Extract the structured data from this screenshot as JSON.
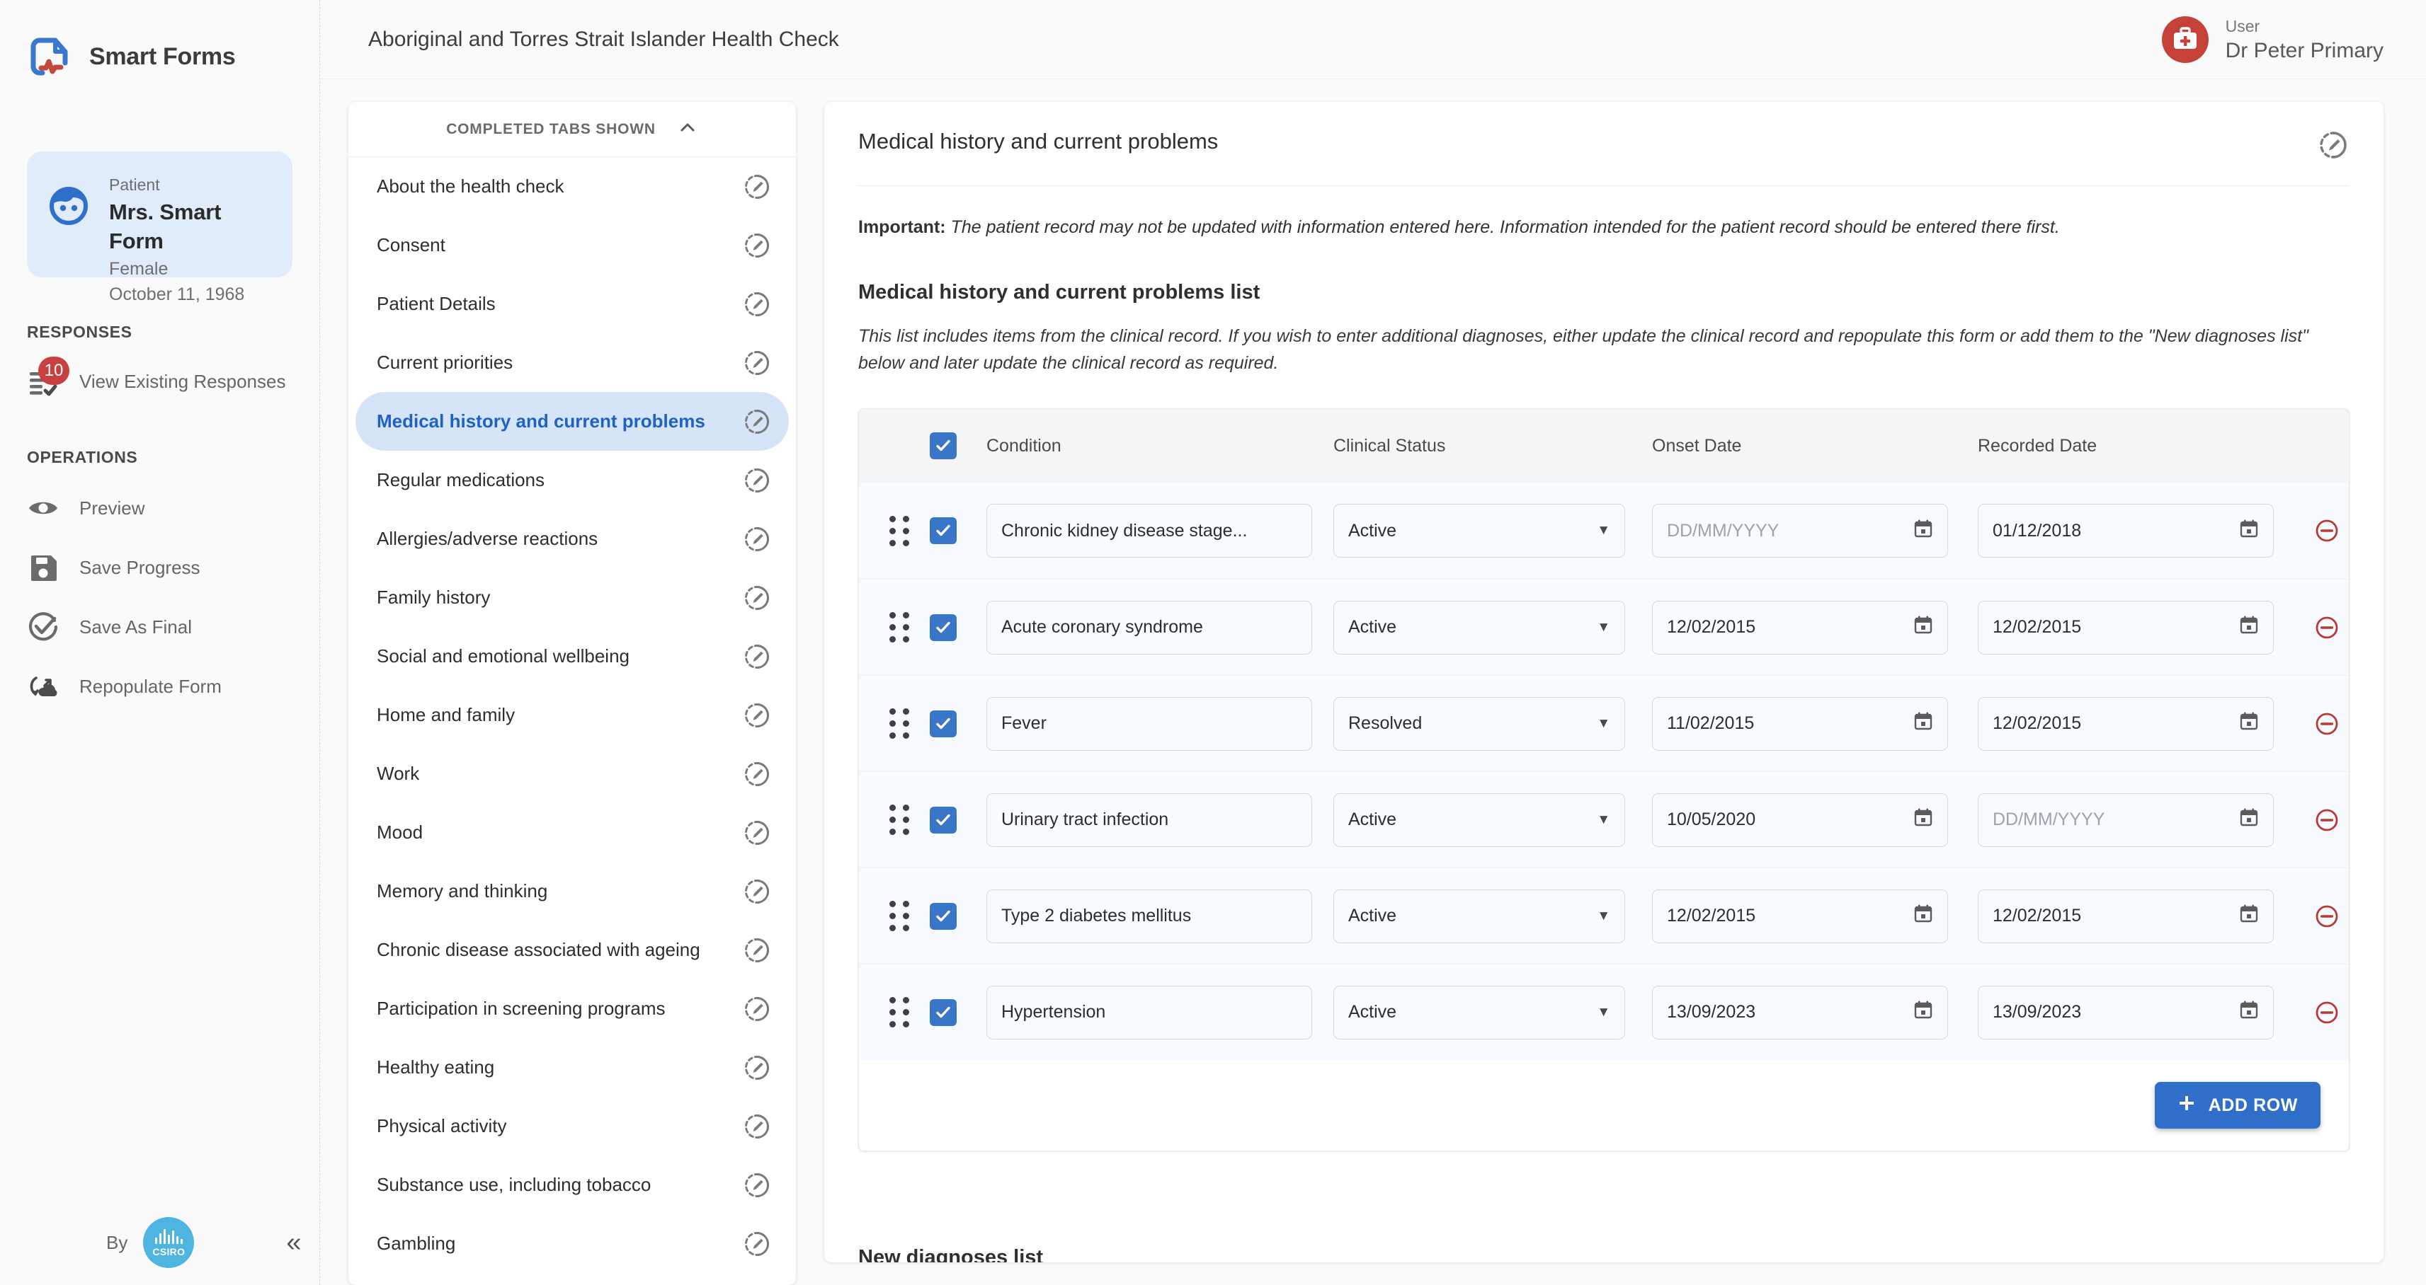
{
  "brand": {
    "name": "Smart Forms",
    "logo_icon": "document-pulse-icon"
  },
  "header": {
    "title": "Aboriginal and Torres Strait Islander Health Check",
    "user_role_label": "User",
    "user_name": "Dr Peter Primary",
    "avatar_icon": "medical-bag-icon"
  },
  "sidebar": {
    "patient": {
      "label": "Patient",
      "name": "Mrs. Smart Form",
      "sex": "Female",
      "dob": "October 11, 1968",
      "avatar_icon": "patient-face-icon"
    },
    "responses_section": "RESPONSES",
    "responses_item": {
      "label": "View Existing Responses",
      "badge": "10",
      "icon": "list-check-icon"
    },
    "operations_section": "OPERATIONS",
    "operations": [
      {
        "label": "Preview",
        "icon": "eye-icon"
      },
      {
        "label": "Save Progress",
        "icon": "floppy-disk-icon"
      },
      {
        "label": "Save As Final",
        "icon": "check-circle-icon"
      },
      {
        "label": "Repopulate Form",
        "icon": "cloud-refresh-icon"
      }
    ],
    "footer": {
      "by_label": "By",
      "org": "CSIRO",
      "collapse_icon": "double-chevron-left-icon"
    }
  },
  "tabcard": {
    "header_label": "COMPLETED TABS SHOWN",
    "header_icon": "chevron-up-icon",
    "status_icon": "pencil-dashed-circle-icon",
    "tabs": [
      {
        "label": "About the health check",
        "active": false
      },
      {
        "label": "Consent",
        "active": false
      },
      {
        "label": "Patient Details",
        "active": false
      },
      {
        "label": "Current priorities",
        "active": false
      },
      {
        "label": "Medical history and current problems",
        "active": true
      },
      {
        "label": "Regular medications",
        "active": false
      },
      {
        "label": "Allergies/adverse reactions",
        "active": false
      },
      {
        "label": "Family history",
        "active": false
      },
      {
        "label": "Social and emotional wellbeing",
        "active": false
      },
      {
        "label": "Home and family",
        "active": false
      },
      {
        "label": "Work",
        "active": false
      },
      {
        "label": "Mood",
        "active": false
      },
      {
        "label": "Memory and thinking",
        "active": false
      },
      {
        "label": "Chronic disease associated with ageing",
        "active": false
      },
      {
        "label": "Participation in screening programs",
        "active": false
      },
      {
        "label": "Healthy eating",
        "active": false
      },
      {
        "label": "Physical activity",
        "active": false
      },
      {
        "label": "Substance use, including tobacco",
        "active": false
      },
      {
        "label": "Gambling",
        "active": false
      }
    ]
  },
  "panel": {
    "title": "Medical history and current problems",
    "head_icon": "pencil-dashed-circle-icon",
    "important_label": "Important:",
    "important_text": " The patient record may not be updated with information entered here. Information intended for the patient record should be entered there first.",
    "list_title": "Medical history and current problems list",
    "list_description": "This list includes items from the clinical record. If you wish to enter additional diagnoses, either update the clinical record and repopulate this form or add them to the \"New diagnoses list\" below and later update the clinical record as required.",
    "next_section_title": "New diagnoses list"
  },
  "table": {
    "select_all_checked": true,
    "columns": [
      "Condition",
      "Clinical Status",
      "Onset Date",
      "Recorded Date"
    ],
    "date_placeholder": "DD/MM/YYYY",
    "handle_icon": "drag-handle-icon",
    "delete_icon": "remove-circle-icon",
    "calendar_icon": "calendar-icon",
    "dropdown_icon": "caret-down-icon",
    "rows": [
      {
        "checked": true,
        "condition": "Chronic kidney disease stage...",
        "status": "Active",
        "onset": "",
        "recorded": "01/12/2018"
      },
      {
        "checked": true,
        "condition": "Acute coronary syndrome",
        "status": "Active",
        "onset": "12/02/2015",
        "recorded": "12/02/2015"
      },
      {
        "checked": true,
        "condition": "Fever",
        "status": "Resolved",
        "onset": "11/02/2015",
        "recorded": "12/02/2015"
      },
      {
        "checked": true,
        "condition": "Urinary tract infection",
        "status": "Active",
        "onset": "10/05/2020",
        "recorded": ""
      },
      {
        "checked": true,
        "condition": "Type 2 diabetes mellitus",
        "status": "Active",
        "onset": "12/02/2015",
        "recorded": "12/02/2015"
      },
      {
        "checked": true,
        "condition": "Hypertension",
        "status": "Active",
        "onset": "13/09/2023",
        "recorded": "13/09/2023"
      }
    ],
    "add_row_label": "ADD ROW",
    "add_row_icon": "plus-icon"
  },
  "colors": {
    "accent_blue": "#2f6fc9",
    "active_tab_bg": "#d6e4f7",
    "active_tab_text": "#1e62c4",
    "badge_red": "#c94040",
    "delete_red": "#b83a33",
    "avatar_red": "#c64137",
    "csiro_blue": "#4db5e0",
    "patient_card_bg": "#e0ecfa",
    "row_bg": "#f7faff",
    "table_head_bg": "#f4f5f7"
  }
}
